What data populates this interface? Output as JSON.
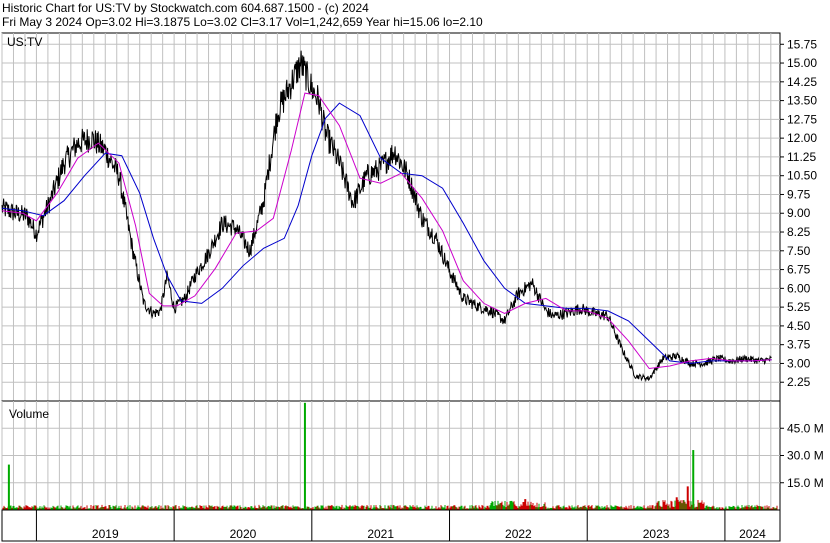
{
  "header": {
    "title": "Historic Chart for US:TV by Stockwatch.com 604.687.1500 - (c) 2024",
    "quote": "Fri May  3 2024   Op=3.02  Hi=3.1875   Lo=3.02   Cl=3.17   Vol=1,242,659   Year hi=15.06   lo=2.10"
  },
  "chart_data": [
    {
      "type": "line",
      "panel_label": "US:TV",
      "yticks": [
        "15.75",
        "15.00",
        "14.25",
        "13.50",
        "12.75",
        "12.00",
        "11.25",
        "10.50",
        "9.75",
        "9.00",
        "8.25",
        "7.50",
        "6.75",
        "6.00",
        "5.25",
        "4.50",
        "3.75",
        "3.00",
        "2.25"
      ],
      "ylim": [
        1.5,
        16.2
      ],
      "xlim": [
        2018.75,
        2024.4
      ],
      "x_ticks": [
        "2019",
        "2020",
        "2021",
        "2022",
        "2023",
        "2024"
      ],
      "price_series": {
        "x": [
          2018.75,
          2018.85,
          2018.93,
          2019.0,
          2019.1,
          2019.2,
          2019.3,
          2019.4,
          2019.5,
          2019.6,
          2019.7,
          2019.78,
          2019.85,
          2019.9,
          2019.95,
          2020.0,
          2020.08,
          2020.15,
          2020.25,
          2020.35,
          2020.45,
          2020.55,
          2020.65,
          2020.75,
          2020.85,
          2020.92,
          2021.0,
          2021.05,
          2021.1,
          2021.2,
          2021.3,
          2021.4,
          2021.5,
          2021.6,
          2021.7,
          2021.8,
          2021.9,
          2022.0,
          2022.1,
          2022.2,
          2022.3,
          2022.4,
          2022.5,
          2022.6,
          2022.7,
          2022.75,
          2022.85,
          2022.95,
          2023.05,
          2023.15,
          2023.25,
          2023.35,
          2023.45,
          2023.55,
          2023.65,
          2023.75,
          2023.85,
          2023.95,
          2024.05,
          2024.15,
          2024.25,
          2024.34
        ],
        "y": [
          9.2,
          9.0,
          8.9,
          8.2,
          9.5,
          11.0,
          11.8,
          12.0,
          11.5,
          10.5,
          7.5,
          5.4,
          5.0,
          5.1,
          6.5,
          5.2,
          5.6,
          6.5,
          7.4,
          8.6,
          8.4,
          7.5,
          9.5,
          13.0,
          14.2,
          15.0,
          14.0,
          13.5,
          12.2,
          11.0,
          9.4,
          10.5,
          10.8,
          11.5,
          10.5,
          8.8,
          8.0,
          6.7,
          5.6,
          5.3,
          5.1,
          4.7,
          5.8,
          6.2,
          5.1,
          4.9,
          5.0,
          5.2,
          5.0,
          4.9,
          3.6,
          2.5,
          2.4,
          3.2,
          3.3,
          3.0,
          3.0,
          3.2,
          3.1,
          3.2,
          3.1,
          3.17
        ]
      },
      "moving_average_short": {
        "x": [
          2018.75,
          2018.9,
          2019.0,
          2019.15,
          2019.3,
          2019.45,
          2019.6,
          2019.72,
          2019.82,
          2019.92,
          2020.02,
          2020.15,
          2020.3,
          2020.45,
          2020.6,
          2020.72,
          2020.85,
          2020.95,
          2021.05,
          2021.2,
          2021.35,
          2021.5,
          2021.65,
          2021.8,
          2021.95,
          2022.1,
          2022.25,
          2022.4,
          2022.55,
          2022.7,
          2022.85,
          2023.0,
          2023.15,
          2023.3,
          2023.45,
          2023.6,
          2023.75,
          2023.9,
          2024.05,
          2024.2,
          2024.34
        ],
        "y": [
          9.1,
          9.0,
          8.7,
          9.8,
          11.2,
          11.8,
          11.0,
          8.5,
          5.8,
          5.3,
          5.3,
          5.7,
          6.8,
          8.2,
          8.3,
          8.8,
          11.5,
          13.8,
          13.7,
          12.5,
          10.4,
          10.2,
          10.6,
          9.6,
          8.3,
          6.3,
          5.4,
          5.0,
          5.4,
          5.6,
          5.1,
          5.1,
          4.8,
          3.9,
          2.8,
          2.9,
          3.1,
          3.2,
          3.1,
          3.1,
          3.15
        ]
      },
      "moving_average_long": {
        "x": [
          2018.75,
          2018.9,
          2019.05,
          2019.2,
          2019.35,
          2019.5,
          2019.62,
          2019.75,
          2019.85,
          2019.95,
          2020.05,
          2020.2,
          2020.35,
          2020.5,
          2020.65,
          2020.8,
          2020.9,
          2021.0,
          2021.1,
          2021.2,
          2021.35,
          2021.5,
          2021.65,
          2021.8,
          2021.95,
          2022.1,
          2022.25,
          2022.4,
          2022.55,
          2022.7,
          2022.85,
          2023.0,
          2023.15,
          2023.3,
          2023.45,
          2023.6,
          2023.75,
          2023.9,
          2024.05,
          2024.2,
          2024.34
        ],
        "y": [
          9.2,
          9.1,
          8.9,
          9.5,
          10.5,
          11.4,
          11.3,
          9.8,
          8.0,
          6.5,
          5.5,
          5.4,
          6.0,
          6.9,
          7.6,
          8.0,
          9.3,
          11.3,
          12.8,
          13.4,
          12.9,
          11.2,
          10.6,
          10.5,
          10.0,
          8.6,
          7.1,
          6.0,
          5.4,
          5.3,
          5.2,
          5.2,
          5.1,
          4.7,
          3.9,
          3.1,
          3.0,
          3.1,
          3.1,
          3.1,
          3.15
        ]
      },
      "colors": {
        "price": "#000000",
        "ma_short": "#cc00cc",
        "ma_long": "#0000cc",
        "grid": "#c0c0c0"
      },
      "grid": true
    },
    {
      "type": "bar",
      "panel_label": "Volume",
      "yticks": [
        "45.0 M",
        "30.0 M",
        "15.0 M"
      ],
      "ylim": [
        0,
        60
      ],
      "units": "M",
      "spikes": [
        {
          "x": 2018.8,
          "value": 25,
          "color": "#00aa00"
        },
        {
          "x": 2020.95,
          "value": 59,
          "color": "#00aa00"
        },
        {
          "x": 2023.73,
          "value": 13,
          "color": "#cc0000"
        },
        {
          "x": 2023.77,
          "value": 33,
          "color": "#00aa00"
        },
        {
          "x": 2022.45,
          "value": 5,
          "color": "#00aa00"
        },
        {
          "x": 2022.55,
          "value": 6,
          "color": "#cc0000"
        },
        {
          "x": 2023.65,
          "value": 7,
          "color": "#cc0000"
        }
      ],
      "colors": {
        "up": "#00aa00",
        "down": "#cc0000"
      }
    }
  ]
}
